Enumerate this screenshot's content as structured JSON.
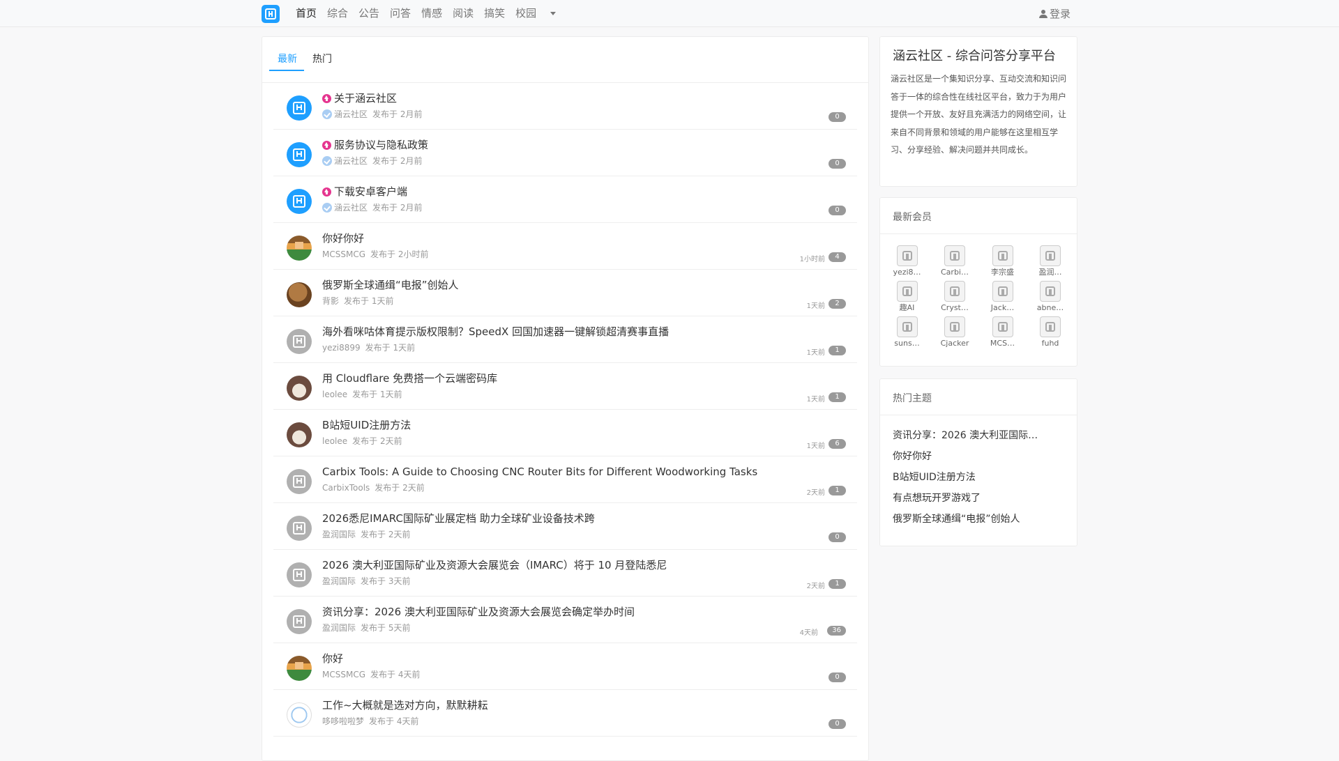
{
  "nav": {
    "items": [
      "首页",
      "综合",
      "公告",
      "问答",
      "情感",
      "阅读",
      "搞笑",
      "校园"
    ],
    "login_label": "登录"
  },
  "tabs": [
    "最新",
    "热门"
  ],
  "topics": [
    {
      "title": "关于涵云社区",
      "author": "涵云社区",
      "posted": "发布于 2月前",
      "last": "",
      "replies": "0",
      "pinned": true,
      "avatar": "logo"
    },
    {
      "title": "服务协议与隐私政策",
      "author": "涵云社区",
      "posted": "发布于 2月前",
      "last": "",
      "replies": "0",
      "pinned": true,
      "avatar": "logo"
    },
    {
      "title": "下载安卓客户端",
      "author": "涵云社区",
      "posted": "发布于 2月前",
      "last": "",
      "replies": "0",
      "pinned": true,
      "avatar": "logo"
    },
    {
      "title": "你好你好",
      "author": "MCSSMCG",
      "posted": "发布于 2小时前",
      "last": "1小时前",
      "replies": "4",
      "pinned": false,
      "avatar": "pixel"
    },
    {
      "title": "俄罗斯全球通缉“电报”创始人",
      "author": "背影",
      "posted": "发布于 1天前",
      "last": "1天前",
      "replies": "2",
      "pinned": false,
      "avatar": "capy"
    },
    {
      "title": "海外看咪咕体育提示版权限制？SpeedX 回国加速器一键解锁超清赛事直播",
      "author": "yezi8899",
      "posted": "发布于 1天前",
      "last": "1天前",
      "replies": "1",
      "pinned": false,
      "avatar": "gray"
    },
    {
      "title": "用 Cloudflare 免费搭一个云端密码库",
      "author": "leolee",
      "posted": "发布于 1天前",
      "last": "1天前",
      "replies": "1",
      "pinned": false,
      "avatar": "bird"
    },
    {
      "title": "B站短UID注册方法",
      "author": "leolee",
      "posted": "发布于 2天前",
      "last": "1天前",
      "replies": "6",
      "pinned": false,
      "avatar": "bird"
    },
    {
      "title": "Carbix Tools: A Guide to Choosing CNC Router Bits for Different Woodworking Tasks",
      "author": "CarbixTools",
      "posted": "发布于 2天前",
      "last": "2天前",
      "replies": "1",
      "pinned": false,
      "avatar": "gray"
    },
    {
      "title": "2026悉尼IMARC国际矿业展定档 助力全球矿业设备技术跨",
      "author": "盈润国际",
      "posted": "发布于 2天前",
      "last": "",
      "replies": "0",
      "pinned": false,
      "avatar": "gray"
    },
    {
      "title": "2026 澳大利亚国际矿业及资源大会展览会（IMARC）将于 10 月登陆悉尼",
      "author": "盈润国际",
      "posted": "发布于 3天前",
      "last": "2天前",
      "replies": "1",
      "pinned": false,
      "avatar": "gray"
    },
    {
      "title": "资讯分享：2026 澳大利亚国际矿业及资源大会展览会确定举办时间",
      "author": "盈润国际",
      "posted": "发布于 5天前",
      "last": "4天前",
      "replies": "36",
      "pinned": false,
      "avatar": "gray"
    },
    {
      "title": "你好",
      "author": "MCSSMCG",
      "posted": "发布于 4天前",
      "last": "",
      "replies": "0",
      "pinned": false,
      "avatar": "pixel"
    },
    {
      "title": "工作~大概就是选对方向，默默耕耘",
      "author": "哆哆啦啦梦",
      "posted": "发布于 4天前",
      "last": "",
      "replies": "0",
      "pinned": false,
      "avatar": "cartoon"
    }
  ],
  "intro": {
    "title": "涵云社区 - 综合问答分享平台",
    "text": "涵云社区是一个集知识分享、互动交流和知识问答于一体的综合性在线社区平台，致力于为用户提供一个开放、友好且充满活力的网络空间，让来自不同背景和领域的用户能够在这里相互学习、分享经验、解决问题并共同成长。"
  },
  "members": {
    "title": "最新会员",
    "names": [
      "yezi8…",
      "Carbi…",
      "李宗盛",
      "盈润…",
      "趣AI",
      "Cryst…",
      "Jack…",
      "abne…",
      "suns…",
      "Cjacker",
      "MCS…",
      "fuhd"
    ]
  },
  "hot": {
    "title": "热门主题",
    "items": [
      "资讯分享：2026 澳大利亚国际…",
      "你好你好",
      "B站短UID注册方法",
      "有点想玩开罗游戏了",
      "俄罗斯全球通缉“电报”创始人"
    ]
  },
  "colors": {
    "accent": "#1e9fff",
    "pin": "#e5358f",
    "badge": "#999999"
  }
}
